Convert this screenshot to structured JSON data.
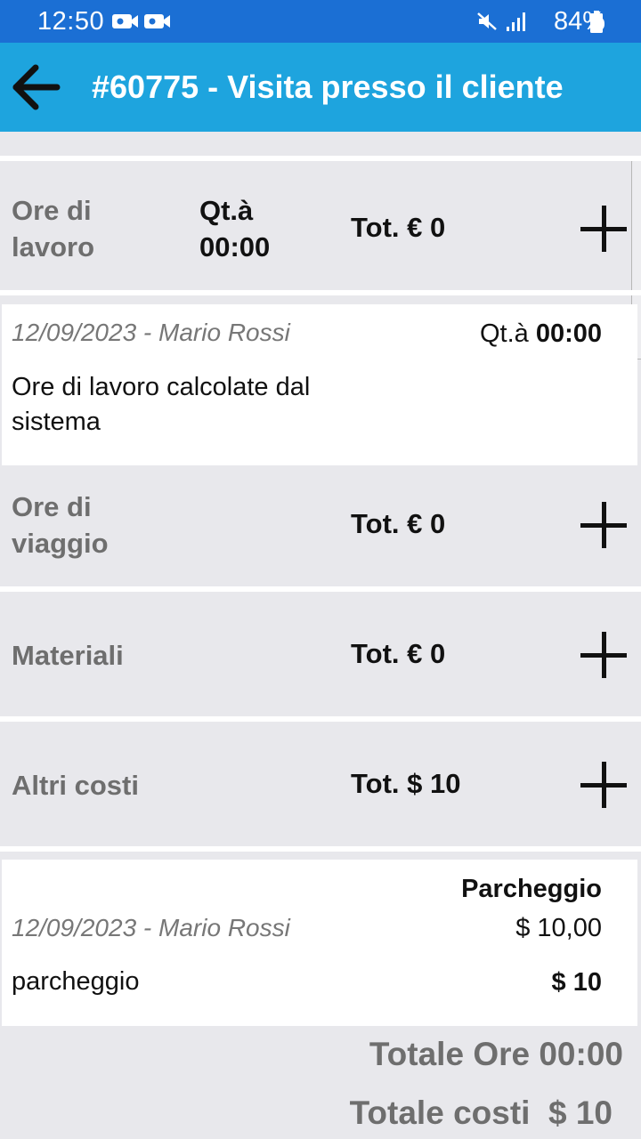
{
  "status_bar": {
    "time": "12:50",
    "battery": "84%"
  },
  "app_bar": {
    "title": "#60775 - Visita presso il cliente"
  },
  "sections": [
    {
      "title": "Ore di lavoro",
      "qty_label": "Qt.à",
      "qty_value": "00:00",
      "total": "Tot. € 0"
    },
    {
      "title": "Ore di viaggio",
      "total": "Tot. € 0"
    },
    {
      "title": "Materiali",
      "total": "Tot. € 0"
    },
    {
      "title": "Altri costi",
      "total": "Tot. $ 10"
    }
  ],
  "work_entry": {
    "date_user": "12/09/2023 - Mario Rossi",
    "qty_label": "Qt.à",
    "qty_value": "00:00",
    "description": "Ore di lavoro calcolate dal sistema"
  },
  "cost_entry": {
    "item_name": "Parcheggio",
    "date_user": "12/09/2023 - Mario Rossi",
    "unit_price": "$ 10,00",
    "description": "parcheggio",
    "amount": "$ 10"
  },
  "totals": {
    "hours": "Totale Ore 00:00",
    "costs": "Totale costi  $ 10"
  },
  "colors": {
    "status_bar": "#1b6fd4",
    "app_bar": "#1ea4de",
    "background": "#e8e8ec"
  }
}
